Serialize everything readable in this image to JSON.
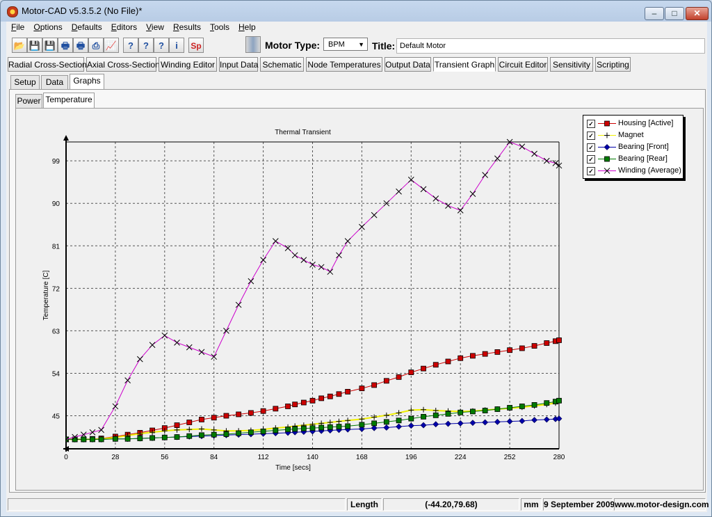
{
  "window": {
    "title": "Motor-CAD v5.3.5.2 (No File)*",
    "controls": {
      "minimize": "–",
      "maximize": "□",
      "close": "✕"
    }
  },
  "menubar": {
    "items": [
      {
        "label": "File",
        "accel": "F"
      },
      {
        "label": "Options",
        "accel": "O"
      },
      {
        "label": "Defaults",
        "accel": "D"
      },
      {
        "label": "Editors",
        "accel": "E"
      },
      {
        "label": "View",
        "accel": "V"
      },
      {
        "label": "Results",
        "accel": "R"
      },
      {
        "label": "Tools",
        "accel": "T"
      },
      {
        "label": "Help",
        "accel": "H"
      }
    ]
  },
  "toolbar": {
    "buttons": [
      {
        "name": "open-folder-icon",
        "glyph": "📂"
      },
      {
        "name": "save-icon",
        "glyph": "💾"
      },
      {
        "name": "save-as-icon",
        "glyph": "💾"
      },
      {
        "name": "print-icon",
        "glyph": "🖶"
      },
      {
        "name": "print-setup-icon",
        "glyph": "🖶"
      },
      {
        "name": "export-icon",
        "glyph": "⎙"
      },
      {
        "name": "chart-icon",
        "glyph": "📈"
      },
      {
        "name": "help-icon",
        "glyph": "?"
      },
      {
        "name": "help-topics-icon",
        "glyph": "?"
      },
      {
        "name": "context-help-icon",
        "glyph": "?"
      },
      {
        "name": "info-icon",
        "glyph": "i"
      },
      {
        "name": "sp-icon",
        "glyph": "Sp"
      }
    ],
    "motor_type_label": "Motor Type:",
    "motor_type_value": "BPM",
    "title_label": "Title:",
    "title_value": "Default Motor"
  },
  "main_tabs": [
    "Radial Cross-Section",
    "Axial Cross-Section",
    "Winding Editor",
    "Input Data",
    "Schematic",
    "Node Temperatures",
    "Output Data",
    "Transient Graph",
    "Circuit Editor",
    "Sensitivity",
    "Scripting"
  ],
  "active_main_tab": "Transient Graph",
  "sub_tabs": [
    "Setup",
    "Data",
    "Graphs"
  ],
  "graph_tabs": [
    "Power",
    "Temperature"
  ],
  "legend": [
    {
      "label": "Housing [Active]",
      "color": "#cc0000",
      "marker": "square",
      "checked": "✓"
    },
    {
      "label": "Magnet",
      "color": "#f0f000",
      "marker": "plus",
      "checked": "✓"
    },
    {
      "label": "Bearing [Front]",
      "color": "#0000aa",
      "marker": "diamond",
      "checked": "✓"
    },
    {
      "label": "Bearing [Rear]",
      "color": "#007a00",
      "marker": "square",
      "checked": "✓"
    },
    {
      "label": "Winding (Average)",
      "color": "#cc00cc",
      "marker": "x",
      "checked": "✓"
    }
  ],
  "chart_data": {
    "type": "line",
    "title": "Thermal Transient",
    "xlabel": "Time [secs]",
    "ylabel": "Temperature [C]",
    "xlim": [
      0,
      280
    ],
    "ylim": [
      38,
      103
    ],
    "xticks": [
      0,
      28,
      56,
      84,
      112,
      140,
      168,
      196,
      224,
      252,
      280
    ],
    "yticks": [
      45,
      54,
      63,
      72,
      81,
      90,
      99
    ],
    "grid": true,
    "legend_position": "top-right",
    "series": [
      {
        "name": "Housing [Active]",
        "color": "#cc0000",
        "marker": "square",
        "x": [
          0,
          5,
          10,
          15,
          20,
          28,
          35,
          42,
          49,
          56,
          63,
          70,
          77,
          84,
          91,
          98,
          105,
          112,
          119,
          126,
          130,
          135,
          140,
          145,
          150,
          155,
          160,
          168,
          175,
          182,
          189,
          196,
          203,
          210,
          217,
          224,
          231,
          238,
          245,
          252,
          259,
          266,
          273,
          278,
          280
        ],
        "y": [
          40.0,
          40.0,
          40.0,
          40.1,
          40.2,
          40.6,
          41.0,
          41.4,
          41.9,
          42.4,
          43.0,
          43.6,
          44.2,
          44.6,
          45.0,
          45.3,
          45.6,
          46.0,
          46.5,
          47.0,
          47.4,
          47.8,
          48.2,
          48.7,
          49.1,
          49.6,
          50.1,
          50.8,
          51.5,
          52.4,
          53.2,
          54.2,
          55.0,
          55.8,
          56.5,
          57.2,
          57.7,
          58.1,
          58.5,
          58.9,
          59.3,
          59.8,
          60.4,
          60.8,
          61.0
        ]
      },
      {
        "name": "Magnet",
        "color": "#f0f000",
        "marker": "plus",
        "x": [
          0,
          5,
          10,
          15,
          20,
          28,
          35,
          42,
          49,
          56,
          63,
          70,
          77,
          84,
          91,
          98,
          105,
          112,
          119,
          126,
          130,
          135,
          140,
          145,
          150,
          155,
          160,
          168,
          175,
          182,
          189,
          196,
          203,
          210,
          217,
          224,
          231,
          238,
          245,
          252,
          259,
          266,
          273,
          278,
          280
        ],
        "y": [
          40.0,
          40.0,
          40.0,
          40.0,
          40.1,
          40.4,
          40.8,
          41.2,
          41.5,
          41.8,
          42.0,
          42.1,
          42.2,
          42.0,
          41.8,
          41.8,
          41.9,
          42.1,
          42.4,
          42.6,
          42.8,
          43.0,
          43.2,
          43.4,
          43.6,
          43.8,
          44.0,
          44.3,
          44.7,
          45.1,
          45.6,
          46.2,
          46.3,
          46.1,
          46.0,
          45.9,
          46.0,
          46.2,
          46.4,
          46.6,
          46.8,
          47.1,
          47.4,
          47.7,
          47.9
        ]
      },
      {
        "name": "Bearing [Front]",
        "color": "#0000aa",
        "marker": "diamond",
        "x": [
          0,
          5,
          10,
          15,
          20,
          28,
          35,
          42,
          49,
          56,
          63,
          70,
          77,
          84,
          91,
          98,
          105,
          112,
          119,
          126,
          130,
          135,
          140,
          145,
          150,
          155,
          160,
          168,
          175,
          182,
          189,
          196,
          203,
          210,
          217,
          224,
          231,
          238,
          245,
          252,
          259,
          266,
          273,
          278,
          280
        ],
        "y": [
          40.0,
          40.0,
          40.0,
          40.0,
          40.0,
          40.1,
          40.1,
          40.2,
          40.3,
          40.4,
          40.5,
          40.6,
          40.7,
          40.8,
          40.9,
          41.0,
          41.1,
          41.2,
          41.3,
          41.4,
          41.5,
          41.6,
          41.7,
          41.8,
          41.9,
          42.0,
          42.1,
          42.2,
          42.4,
          42.5,
          42.7,
          42.9,
          43.0,
          43.2,
          43.3,
          43.4,
          43.5,
          43.6,
          43.7,
          43.8,
          43.9,
          44.1,
          44.2,
          44.3,
          44.4
        ]
      },
      {
        "name": "Bearing [Rear]",
        "color": "#007a00",
        "marker": "square",
        "x": [
          0,
          5,
          10,
          15,
          20,
          28,
          35,
          42,
          49,
          56,
          63,
          70,
          77,
          84,
          91,
          98,
          105,
          112,
          119,
          126,
          130,
          135,
          140,
          145,
          150,
          155,
          160,
          168,
          175,
          182,
          189,
          196,
          203,
          210,
          217,
          224,
          231,
          238,
          245,
          252,
          259,
          266,
          273,
          278,
          280
        ],
        "y": [
          40.0,
          40.0,
          40.0,
          40.0,
          40.0,
          40.1,
          40.1,
          40.2,
          40.3,
          40.4,
          40.5,
          40.7,
          40.9,
          41.0,
          41.1,
          41.3,
          41.5,
          41.7,
          41.9,
          42.1,
          42.2,
          42.3,
          42.4,
          42.5,
          42.6,
          42.7,
          42.8,
          43.1,
          43.4,
          43.7,
          44.0,
          44.4,
          44.8,
          45.1,
          45.4,
          45.7,
          45.9,
          46.1,
          46.4,
          46.7,
          47.0,
          47.3,
          47.7,
          48.0,
          48.2
        ]
      },
      {
        "name": "Winding (Average)",
        "color": "#cc00cc",
        "marker": "x",
        "x": [
          0,
          5,
          10,
          15,
          20,
          28,
          35,
          42,
          49,
          56,
          63,
          70,
          77,
          84,
          91,
          98,
          105,
          112,
          119,
          126,
          130,
          135,
          140,
          145,
          150,
          155,
          160,
          168,
          175,
          182,
          189,
          196,
          203,
          210,
          217,
          224,
          231,
          238,
          245,
          252,
          259,
          266,
          273,
          278,
          280
        ],
        "y": [
          40.0,
          40.5,
          41.0,
          41.5,
          42.0,
          47.0,
          52.5,
          57.0,
          60.0,
          62.0,
          60.5,
          59.5,
          58.5,
          57.5,
          63.0,
          68.5,
          73.5,
          78.0,
          82.0,
          80.5,
          79.0,
          78.0,
          77.0,
          76.5,
          75.5,
          79.0,
          82.0,
          85.0,
          87.5,
          90.0,
          92.5,
          95.0,
          93.0,
          91.0,
          89.5,
          88.5,
          92.0,
          96.0,
          99.5,
          103.0,
          102.0,
          100.5,
          99.0,
          98.5,
          98.0
        ]
      }
    ]
  },
  "statusbar": {
    "field1": "",
    "length_label": "Length",
    "coords": "(-44.20,79.68)",
    "unit": "mm",
    "date": "9 September 2009",
    "website": "www.motor-design.com"
  }
}
